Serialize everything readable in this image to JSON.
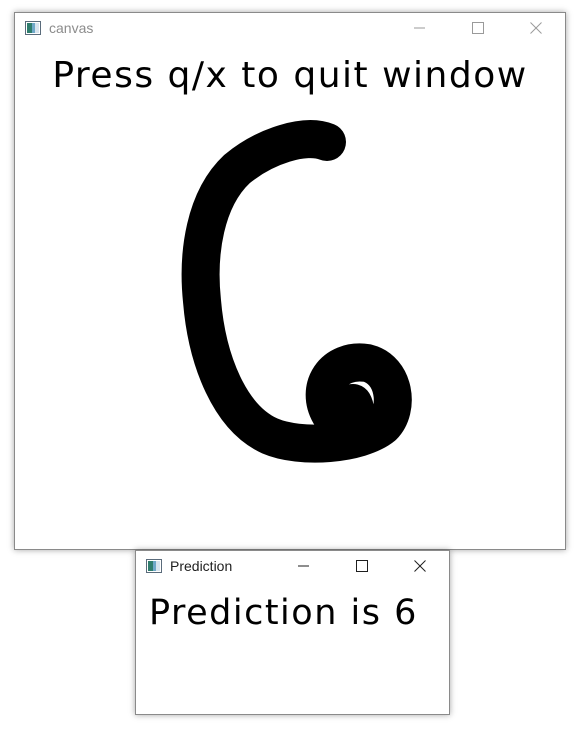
{
  "canvas_window": {
    "title": "canvas",
    "message": "Press q/x to quit window",
    "drawn_digit": "6"
  },
  "prediction_window": {
    "title": "Prediction",
    "message": "Prediction is 6"
  },
  "icons": {
    "app": "opencv-window-icon",
    "minimize": "minimize-icon",
    "maximize": "maximize-icon",
    "close": "close-icon"
  },
  "colors": {
    "ink": "#000000",
    "canvas_background": "#ffffff",
    "inactive_title": "#8c8c8c",
    "active_title": "#1e1e1e"
  }
}
